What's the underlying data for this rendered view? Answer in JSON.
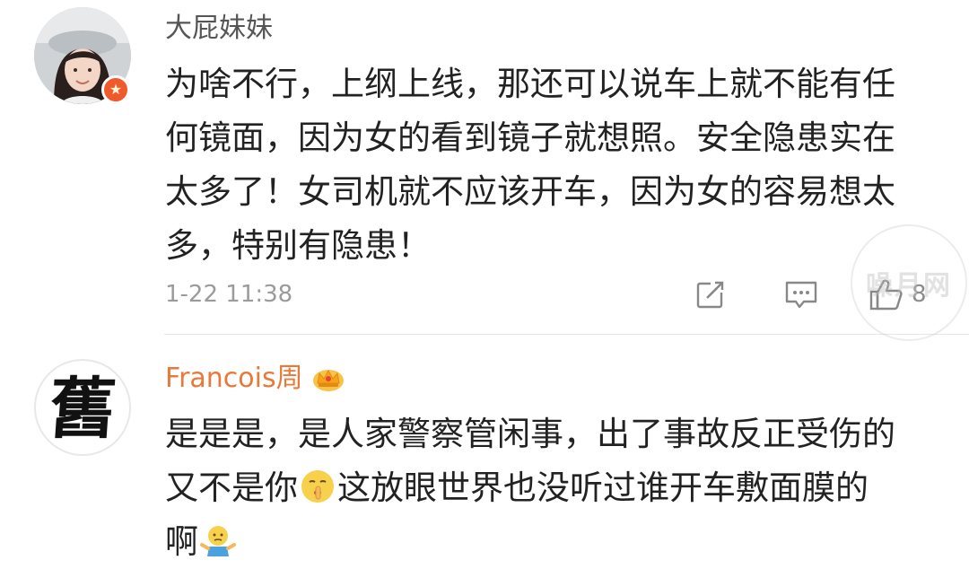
{
  "comments": [
    {
      "username": "大屁妹妹",
      "lines": [
        "为啥不行，上纲上线，那还可以说车上就不能有任",
        "何镜面，因为女的看到镜子就想照。安全隐患实在",
        "太多了！女司机就不应该开车，因为女的容易想太",
        "多，特别有隐患！"
      ],
      "timestamp": "1-22 11:38",
      "like_count": "8"
    },
    {
      "username": "Francois周",
      "avatar_glyph": "舊",
      "line1": "是是是，是人家警察管闲事，出了事故反正受伤的",
      "line2_before": "又不是你",
      "line2_after": "这放眼世界也没听过谁开车敷面膜的",
      "line3": "啊"
    }
  ],
  "watermark": "噪月网",
  "icons": {
    "share": "share-icon",
    "reply": "comment-icon",
    "like": "thumbs-up-icon",
    "vip": "vip-star-badge-icon",
    "crown": "crown-badge-icon",
    "shush": "shushing-face-emoji",
    "shrug": "shrugging-emoji"
  },
  "colors": {
    "username_gray": "#555555",
    "username_orange": "#e8793a",
    "text": "#222222",
    "meta": "#9b9b9b",
    "badge_orange": "#f05a2a"
  }
}
